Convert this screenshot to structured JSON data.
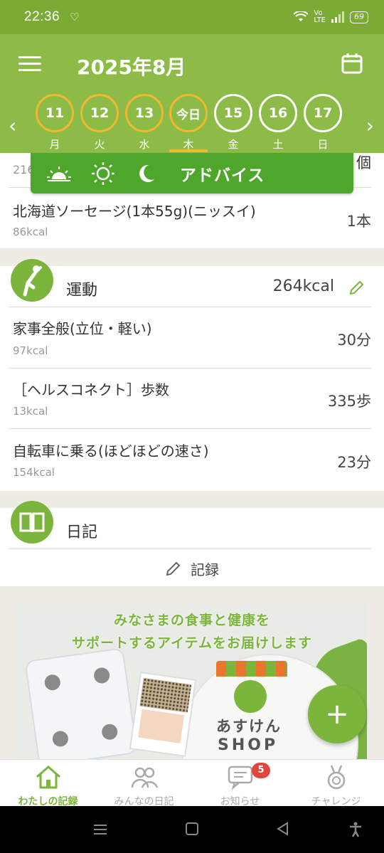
{
  "status_bar": {
    "time": "22:36",
    "battery": "69"
  },
  "header": {
    "title": "2025年8月"
  },
  "days": [
    {
      "num": "11",
      "dow": "月",
      "state": "past"
    },
    {
      "num": "12",
      "dow": "火",
      "state": "past"
    },
    {
      "num": "13",
      "dow": "水",
      "state": "past"
    },
    {
      "num": "今日",
      "dow": "木",
      "state": "today"
    },
    {
      "num": "15",
      "dow": "金",
      "state": "future"
    },
    {
      "num": "16",
      "dow": "土",
      "state": "future"
    },
    {
      "num": "17",
      "dow": "日",
      "state": "future"
    }
  ],
  "advice": {
    "label": "アドバイス"
  },
  "food": {
    "prev_kcal_partial": "216",
    "prev_count_partial": "個",
    "items": [
      {
        "name": "北海道ソーセージ(1本55g)(ニッスイ)",
        "kcal": "86kcal",
        "qty": "1本"
      }
    ]
  },
  "exercise": {
    "title": "運動",
    "total": "264kcal",
    "items": [
      {
        "name": "家事全般(立位・軽い)",
        "kcal": "97kcal",
        "qty": "30分"
      },
      {
        "name": "［ヘルスコネクト］歩数",
        "kcal": "13kcal",
        "qty": "335歩"
      },
      {
        "name": "自転車に乗る(ほどほどの速さ)",
        "kcal": "154kcal",
        "qty": "23分"
      }
    ]
  },
  "diary": {
    "title": "日記",
    "record_label": "記録"
  },
  "banner": {
    "line1": "みなさまの食事と健康を",
    "line2": "サポートするアイテムをお届けします",
    "shop_line1": "あすけん",
    "shop_line2": "SHOP"
  },
  "fab": {
    "label": "+"
  },
  "bottom_nav": [
    {
      "label": "わたしの記録",
      "active": true
    },
    {
      "label": "みんなの日記",
      "active": false
    },
    {
      "label": "お知らせ",
      "active": false
    },
    {
      "label": "チャレンジ",
      "active": false
    }
  ],
  "notification_badge": "5",
  "colors": {
    "header_green": "#8cbc47",
    "status_green": "#7cab35",
    "accent_green": "#7cb53c",
    "advice_green": "#4ea62a",
    "today_ring": "#f2b82f",
    "badge_red": "#e2463a"
  }
}
